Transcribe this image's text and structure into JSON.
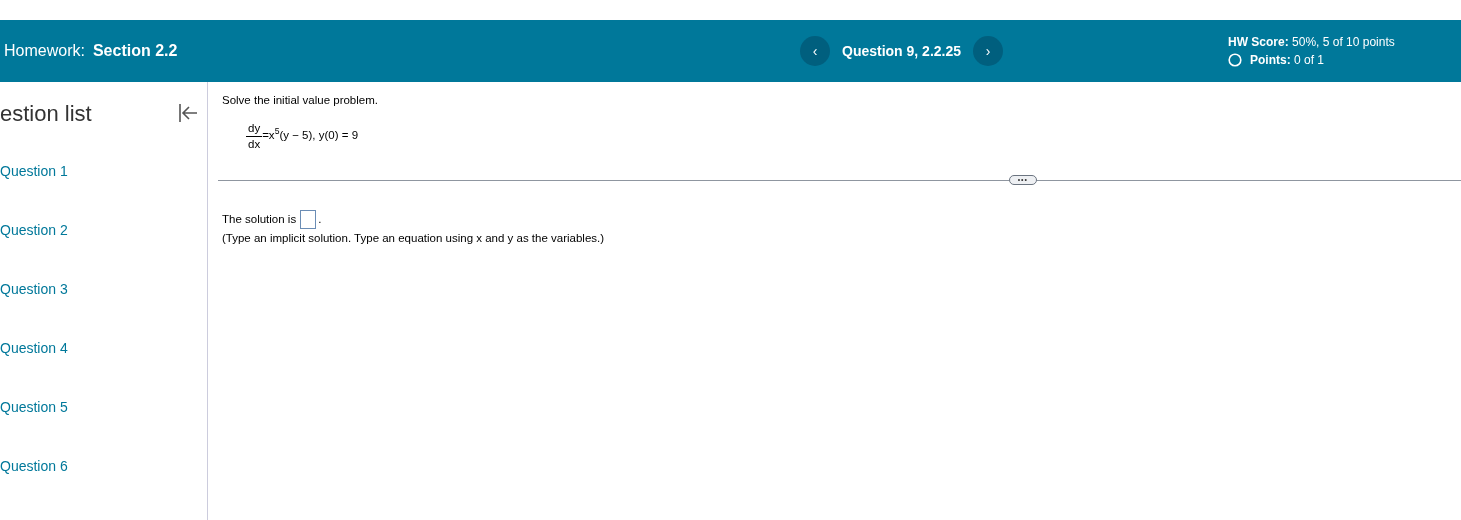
{
  "header": {
    "label": "Homework:",
    "title": "Section 2.2",
    "question": "Question 9, 2.2.25",
    "prev": "‹",
    "next": "›",
    "score_label": "HW Score:",
    "score": "50%, 5 of 10 points",
    "points_label": "Points:",
    "points": "0 of 1"
  },
  "sidebar": {
    "title": "estion list",
    "items": [
      {
        "label": "Question 1"
      },
      {
        "label": "Question 2"
      },
      {
        "label": "Question 3"
      },
      {
        "label": "Question 4"
      },
      {
        "label": "Question 5"
      },
      {
        "label": "Question 6"
      }
    ]
  },
  "question": {
    "prompt": "Solve the initial value problem.",
    "numerator": "dy",
    "denominator": "dx",
    "equation_rest": "=x$^{5}$(y − 5), y(0) = 9",
    "more": "•••",
    "answer_label": "The solution is",
    "answer_end": ".",
    "hint": "(Type an implicit solution. Type an equation using x and y as the variables.)"
  }
}
